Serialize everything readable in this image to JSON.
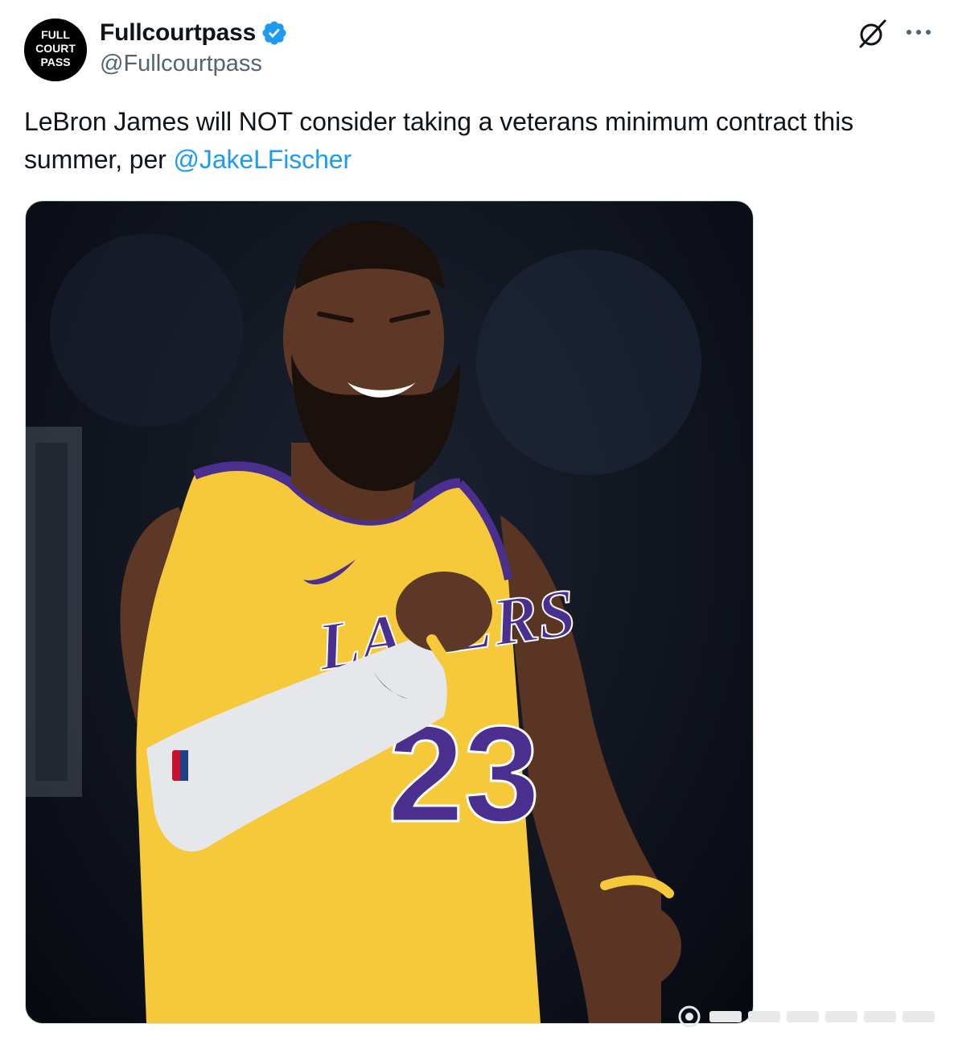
{
  "author": {
    "display_name": "Fullcourtpass",
    "handle": "@Fullcourtpass",
    "avatar_text": [
      "FULL",
      "COURT",
      "PASS"
    ],
    "verified": true
  },
  "actions": {
    "grok_icon": "grok-icon",
    "more_icon": "more-icon"
  },
  "tweet": {
    "text": "LeBron James will NOT consider taking a veterans minimum contract this summer, per ",
    "mention": "@JakeLFischer"
  },
  "media": {
    "jersey_text": "LAKERS",
    "jersey_number": "23"
  },
  "colors": {
    "accent": "#1d9bf0",
    "verified": "#1d9bf0",
    "jersey_gold": "#f5c93a",
    "jersey_purple": "#4a2f8f"
  }
}
